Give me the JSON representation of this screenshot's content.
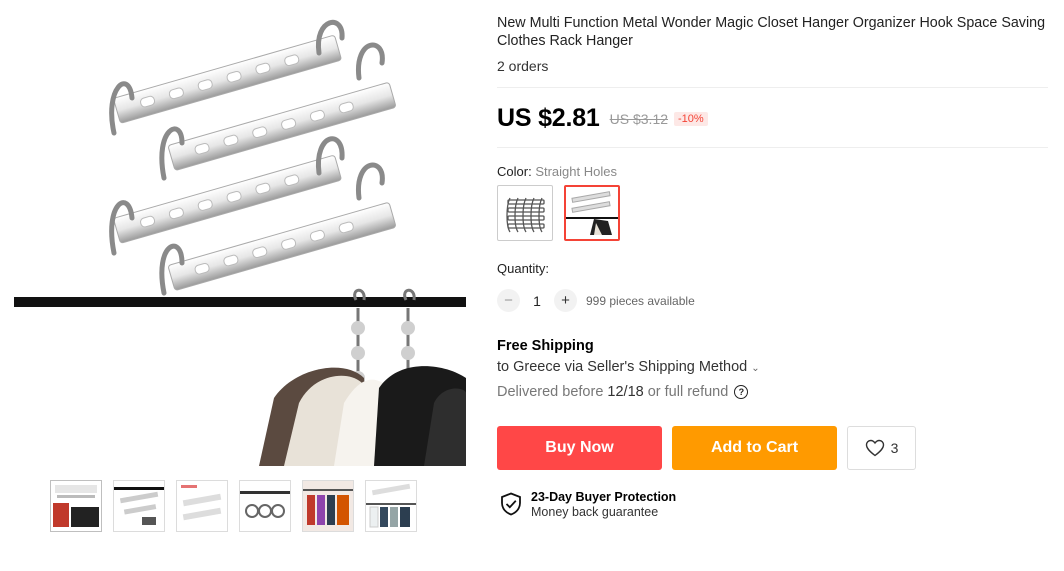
{
  "product": {
    "title": "New Multi Function Metal Wonder Magic Closet Hanger Organizer Hook Space Saving Clothes Rack Hanger",
    "orders": "2 orders"
  },
  "price": {
    "current": "US $2.81",
    "original": "US $3.12",
    "discount": "-10%"
  },
  "color": {
    "label": "Color:",
    "selected": "Straight Holes"
  },
  "quantity": {
    "label": "Quantity:",
    "value": "1",
    "minus": "−",
    "plus": "+",
    "available": "999 pieces available"
  },
  "shipping": {
    "title": "Free Shipping",
    "method": "to Greece via Seller's Shipping Method",
    "delivery_prefix": "Delivered before",
    "delivery_date": "12/18",
    "delivery_suffix": "or full refund",
    "help": "?"
  },
  "actions": {
    "buy_now": "Buy Now",
    "add_to_cart": "Add to Cart",
    "wishlist_count": "3"
  },
  "protection": {
    "title": "23-Day Buyer Protection",
    "subtitle": "Money back guarantee"
  },
  "colors": {
    "buy_now": "#ff4747",
    "add_to_cart": "#ff9a00",
    "discount": "#f44336"
  }
}
